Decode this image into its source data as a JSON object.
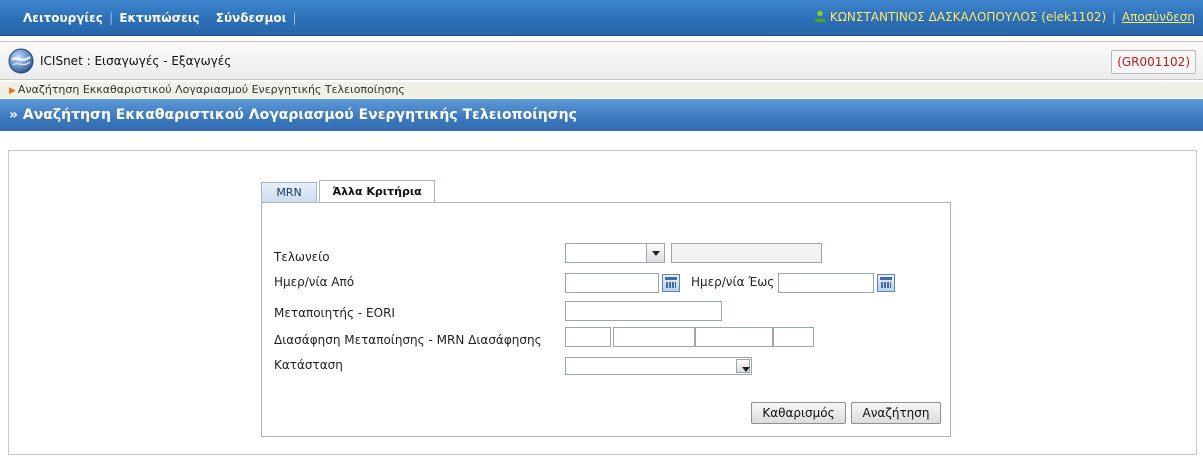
{
  "menubar": {
    "items": [
      "Λειτουργίες",
      "Εκτυπώσεις",
      "Σύνδεσμοι"
    ],
    "user_name": "ΚΩΝΣΤΑΝΤΙΝΟΣ ΔΑΣΚΑΛΟΠΟΥΛΟΣ (elek1102)",
    "logout_label": "Αποσύνδεση",
    "user_icon": "user-icon"
  },
  "appbar": {
    "title": "ICISnet : Εισαγωγές - Εξαγωγές",
    "office_code": "(GR001102)",
    "logo_icon": "icisnet-globe-icon"
  },
  "breadcrumb": {
    "text": "Αναζήτηση Εκκαθαριστικού Λογαριασμού Ενεργητικής Τελειοποίησης"
  },
  "page": {
    "title": "» Αναζήτηση Εκκαθαριστικού Λογαριασμού Ενεργητικής Τελειοποίησης"
  },
  "tabs": [
    {
      "label": "MRN",
      "active": false
    },
    {
      "label": "Άλλα Κριτήρια",
      "active": true
    }
  ],
  "form": {
    "customs_label": "Τελωνείο",
    "customs_code_value": "",
    "customs_name_value": "",
    "date_from_label": "Ημερ/νία Από",
    "date_from_value": "",
    "date_to_label": "Ημερ/νία Έως",
    "date_to_value": "",
    "eori_label": "Μεταποιητής - EORI",
    "eori_value": "",
    "declaration_label": "Διασάφηση Μεταποίησης - MRN Διασάφησης",
    "declaration_parts": [
      "",
      "",
      "",
      ""
    ],
    "status_label": "Κατάσταση",
    "status_value": "",
    "clear_label": "Καθαρισμός",
    "search_label": "Αναζήτηση"
  },
  "colors": {
    "menubar": "#2b6fb7",
    "titlebar": "#3b78bd",
    "user_text": "#ffe86a",
    "office_code": "#c0191a",
    "breadcrumb_arrow": "#e07b1a"
  }
}
